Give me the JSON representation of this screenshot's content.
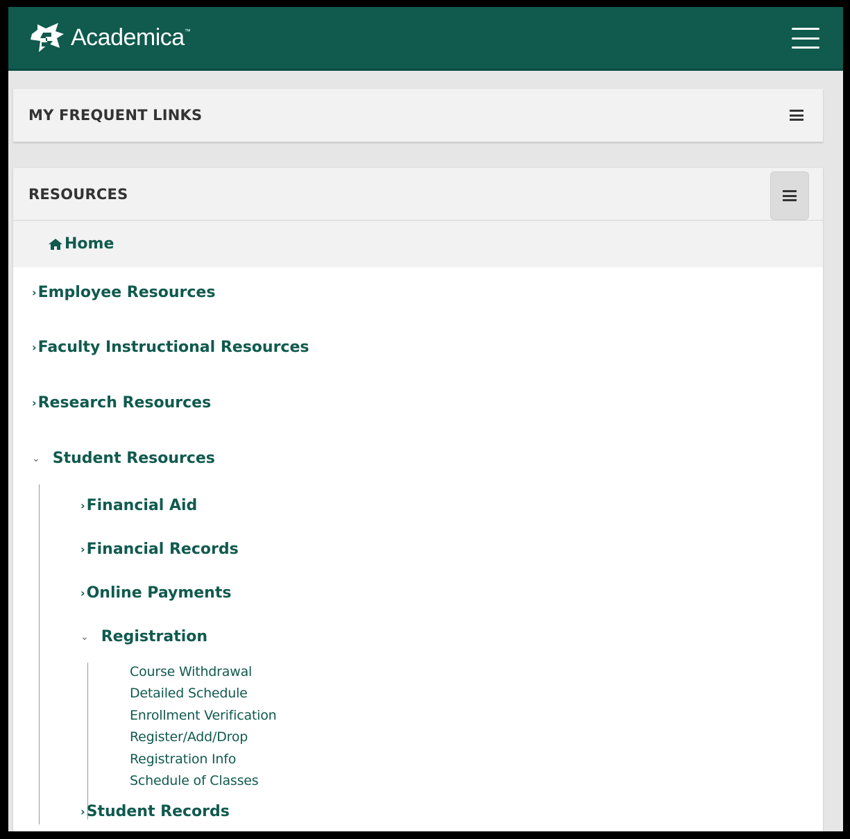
{
  "app": {
    "brand_name": "Academica",
    "brand_mark": "™",
    "accent_color": "#105a4e"
  },
  "frequent_links": {
    "title": "MY FREQUENT LINKS",
    "menu_icon": "bars-icon"
  },
  "resources": {
    "title": "RESOURCES",
    "menu_icon": "bars-icon",
    "home_label": "Home",
    "home_icon": "home-icon",
    "items": [
      {
        "label": "Employee Resources",
        "icon": "chevron-right-icon",
        "chevron": "›"
      },
      {
        "label": "Faculty Instructional Resources",
        "icon": "chevron-right-icon",
        "chevron": "›"
      },
      {
        "label": "Research Resources",
        "icon": "chevron-right-icon",
        "chevron": "›"
      },
      {
        "label": "Student Resources",
        "icon": "chevron-down-icon",
        "chevron": "⌄"
      }
    ],
    "student": {
      "items": [
        {
          "label": "Financial Aid",
          "chevron": "›"
        },
        {
          "label": "Financial Records",
          "chevron": "›"
        },
        {
          "label": "Online Payments",
          "chevron": "›"
        },
        {
          "label": "Registration",
          "chevron": "⌄"
        },
        {
          "label": "Student Records",
          "chevron": "›"
        }
      ],
      "registration_links": [
        "Course Withdrawal",
        "Detailed Schedule",
        "Enrollment Verification",
        "Register/Add/Drop",
        "Registration Info",
        "Schedule of Classes"
      ]
    }
  }
}
